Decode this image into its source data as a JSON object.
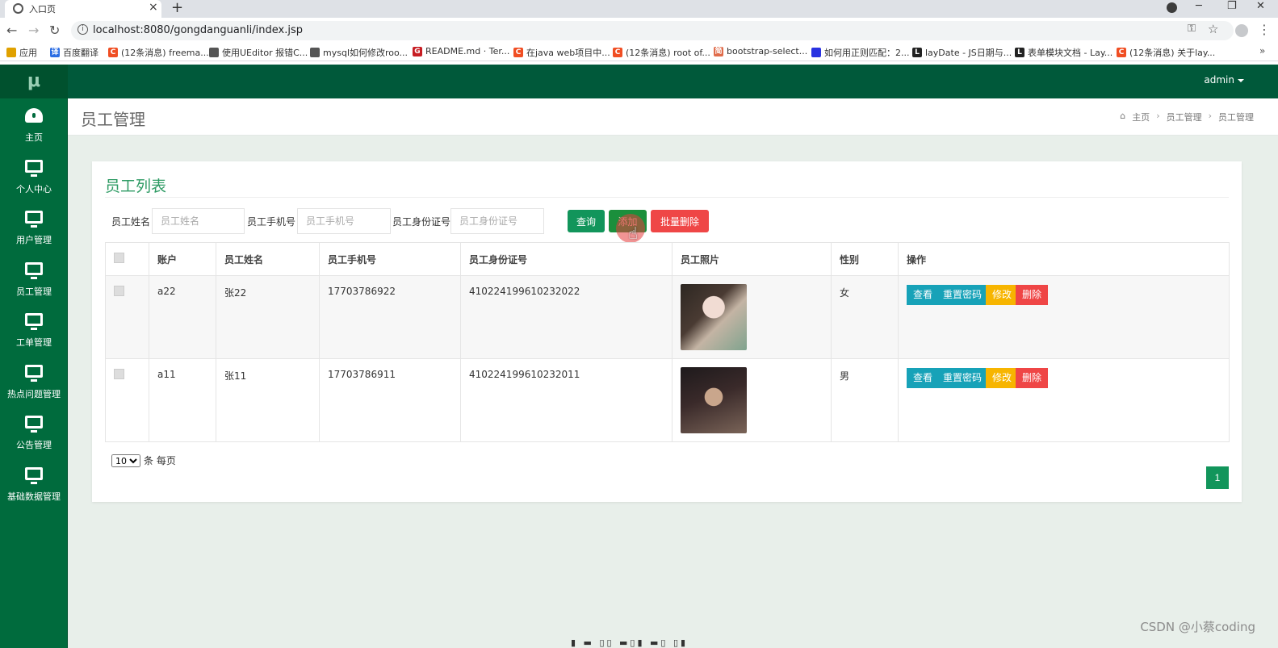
{
  "browser": {
    "tab_title": "入口页",
    "tab_close": "×",
    "new_tab": "+",
    "url": "localhost:8080/gongdanguanli/index.jsp",
    "bookmarks": [
      {
        "label": "应用",
        "color": "#e0a100",
        "glyph": ""
      },
      {
        "label": "百度翻译",
        "color": "#2b6de3",
        "glyph": "译"
      },
      {
        "label": "(12条消息) freema...",
        "color": "#f04e23",
        "glyph": "C"
      },
      {
        "label": "使用UEditor 报错C...",
        "color": "#555555",
        "glyph": ""
      },
      {
        "label": "mysql如何修改roo...",
        "color": "#555555",
        "glyph": ""
      },
      {
        "label": "README.md · Ter...",
        "color": "#c71d23",
        "glyph": "G"
      },
      {
        "label": "在java web项目中...",
        "color": "#f04e23",
        "glyph": "C"
      },
      {
        "label": "(12条消息) root of...",
        "color": "#f04e23",
        "glyph": "C"
      },
      {
        "label": "bootstrap-select...",
        "color": "#e06c4b",
        "glyph": "简"
      },
      {
        "label": "如何用正则匹配：2...",
        "color": "#2932e1",
        "glyph": ""
      },
      {
        "label": "layDate - JS日期与...",
        "color": "#222222",
        "glyph": "L"
      },
      {
        "label": "表单模块文档 - Lay...",
        "color": "#222222",
        "glyph": "L"
      },
      {
        "label": "(12条消息) 关于lay...",
        "color": "#f04e23",
        "glyph": "C"
      }
    ],
    "bookmarks_more": "»"
  },
  "app": {
    "logo": "μ",
    "user_menu": "admin",
    "sidebar": [
      {
        "label": "主页",
        "icon": "dashboard-icon"
      },
      {
        "label": "个人中心",
        "icon": "monitor-icon"
      },
      {
        "label": "用户管理",
        "icon": "monitor-icon"
      },
      {
        "label": "员工管理",
        "icon": "monitor-icon"
      },
      {
        "label": "工单管理",
        "icon": "monitor-icon"
      },
      {
        "label": "热点问题管理",
        "icon": "monitor-icon"
      },
      {
        "label": "公告管理",
        "icon": "monitor-icon"
      },
      {
        "label": "基础数据管理",
        "icon": "monitor-icon"
      }
    ],
    "page_title": "员工管理",
    "breadcrumb": [
      "主页",
      "员工管理",
      "员工管理"
    ],
    "breadcrumb_sep": "›",
    "card_title": "员工列表",
    "search": {
      "name_label": "员工姓名",
      "name_placeholder": "员工姓名",
      "phone_label": "员工手机号",
      "phone_placeholder": "员工手机号",
      "idcard_label": "员工身份证号",
      "idcard_placeholder": "员工身份证号"
    },
    "buttons": {
      "query": "查询",
      "add": "添加",
      "batch_delete": "批量删除"
    },
    "table": {
      "headers": [
        "",
        "账户",
        "员工姓名",
        "员工手机号",
        "员工身份证号",
        "员工照片",
        "性别",
        "操作"
      ],
      "rows": [
        {
          "account": "a22",
          "name": "张22",
          "phone": "17703786922",
          "idcard": "410224199610232022",
          "gender": "女"
        },
        {
          "account": "a11",
          "name": "张11",
          "phone": "17703786911",
          "idcard": "410224199610232011",
          "gender": "男"
        }
      ],
      "actions": {
        "view": "查看",
        "reset_password": "重置密码",
        "edit": "修改",
        "delete": "删除"
      }
    },
    "pager": {
      "page_size": "10",
      "page_size_suffix": "条 每页",
      "current_page": "1"
    }
  },
  "watermark": "CSDN @小蔡coding",
  "colors": {
    "primary": "#006b3d",
    "topbar": "#00593a",
    "accent": "#12955b",
    "danger": "#ef4646",
    "info": "#17a2b8",
    "warning": "#f7b500"
  }
}
